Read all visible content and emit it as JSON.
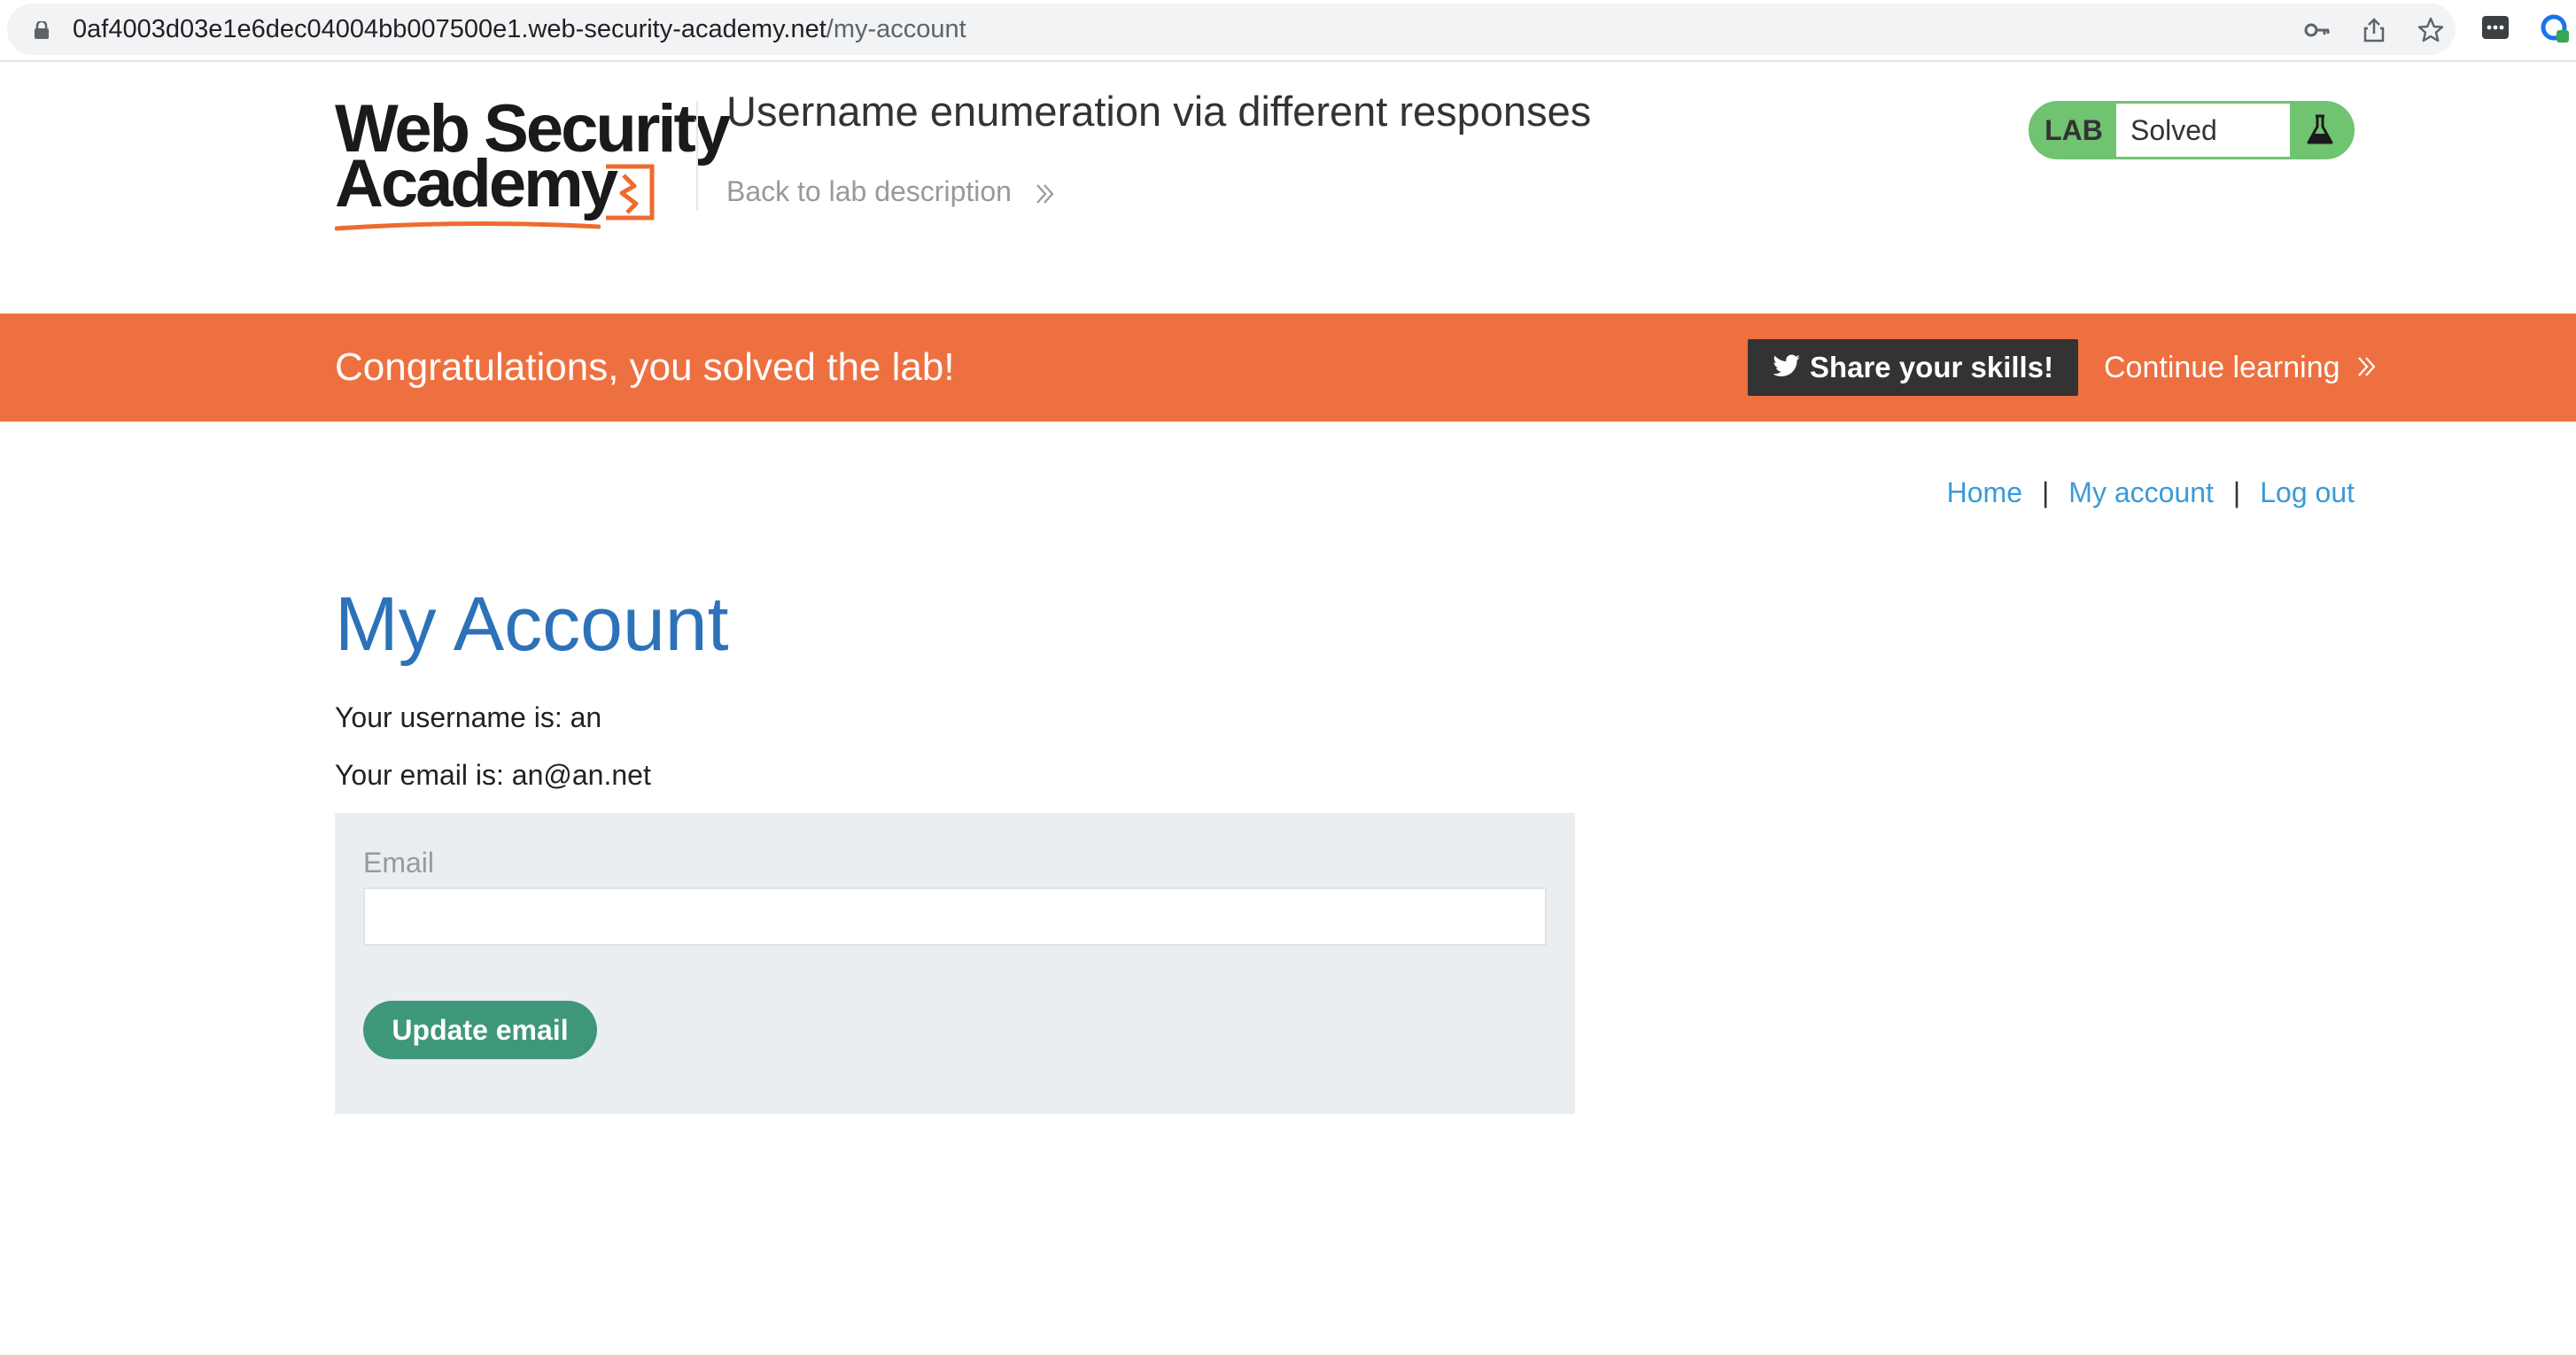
{
  "browser": {
    "url_host": "0af4003d03e1e6dec04004bb007500e1.web-security-academy.net",
    "url_path": "/my-account",
    "icons": [
      "lock-icon",
      "key-icon",
      "share-icon",
      "star-icon",
      "extension-icon",
      "profile-icon"
    ]
  },
  "header": {
    "logo_line1": "Web Security",
    "logo_line2": "Academy",
    "lab_title": "Username enumeration via different responses",
    "back_link": "Back to lab description",
    "lab_label": "LAB",
    "lab_status": "Solved",
    "status_color": "#70c370"
  },
  "banner": {
    "message": "Congratulations, you solved the lab!",
    "share_label": "Share your skills!",
    "continue_label": "Continue learning",
    "color": "#ee7040"
  },
  "nav": {
    "home": "Home",
    "my_account": "My account",
    "log_out": "Log out",
    "separator": "|"
  },
  "main": {
    "title": "My Account",
    "username_line": "Your username is: an",
    "email_line": "Your email is: an@an.net",
    "form": {
      "email_label": "Email",
      "email_value": "",
      "submit_label": "Update email"
    }
  },
  "colors": {
    "link": "#3a9ad9",
    "title": "#2d72b8",
    "button": "#3f9779",
    "form_bg": "#ebeef1"
  }
}
